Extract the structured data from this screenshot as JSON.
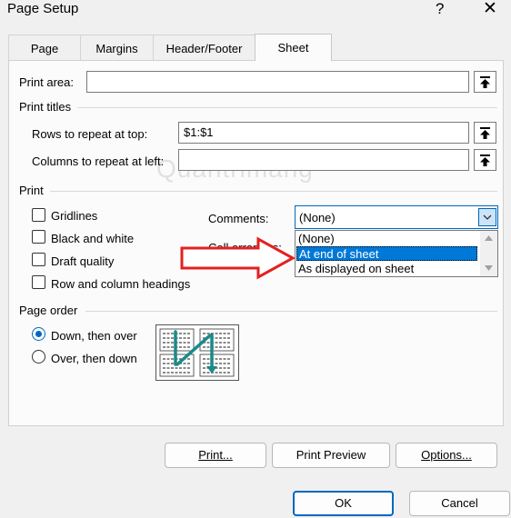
{
  "window": {
    "title": "Page Setup",
    "help": "?",
    "close": "✕"
  },
  "tabs": [
    {
      "label": "Page"
    },
    {
      "label": "Margins"
    },
    {
      "label": "Header/Footer"
    },
    {
      "label": "Sheet"
    }
  ],
  "print_area": {
    "label": "Print area:",
    "value": ""
  },
  "print_titles": {
    "heading": "Print titles",
    "rows_label": "Rows to repeat at top:",
    "rows_value": "$1:$1",
    "cols_label": "Columns to repeat at left:",
    "cols_value": ""
  },
  "print": {
    "heading": "Print",
    "gridlines": "Gridlines",
    "black_white": "Black and white",
    "draft": "Draft quality",
    "row_col_headings": "Row and column headings",
    "comments_label": "Comments:",
    "comments_value": "(None)",
    "cell_errors_label": "Cell errors as:",
    "comments_options": [
      "(None)",
      "At end of sheet",
      "As displayed on sheet"
    ],
    "comments_highlighted": "At end of sheet"
  },
  "page_order": {
    "heading": "Page order",
    "down_over": "Down, then over",
    "over_down": "Over, then down",
    "selected": "Down, then over"
  },
  "buttons": {
    "print": "Print...",
    "print_preview": "Print Preview",
    "options": "Options...",
    "ok": "OK",
    "cancel": "Cancel"
  },
  "watermark": "Quantrimang",
  "colors": {
    "accent": "#0067c0",
    "highlight": "#0078d7",
    "arrow": "#e32020",
    "order_arrow": "#1a8a8a"
  }
}
